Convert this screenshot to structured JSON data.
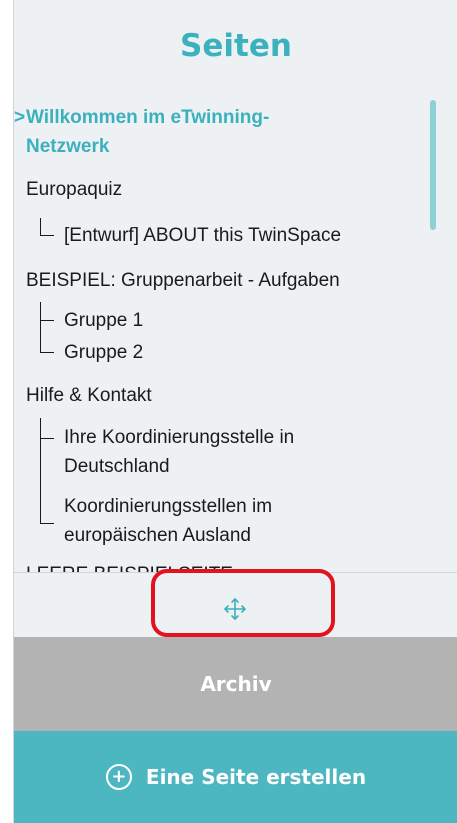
{
  "panel": {
    "title": "Seiten",
    "pages": [
      {
        "label_line1": "Willkommen im eTwinning-",
        "label_line2": "Netzwerk",
        "active": true
      },
      {
        "label": "Europaquiz"
      },
      {
        "label": "[Entwurf] ABOUT this TwinSpace"
      },
      {
        "label": "BEISPIEL: Gruppenarbeit - Aufgaben"
      },
      {
        "label": "Gruppe 1"
      },
      {
        "label": "Gruppe 2"
      },
      {
        "label": "Hilfe & Kontakt"
      },
      {
        "label_line1": "Ihre Koordinierungsstelle in",
        "label_line2": "Deutschland"
      },
      {
        "label_line1": "Koordinierungsstellen im",
        "label_line2": "europäischen Ausland"
      },
      {
        "label": "LEERE BEISPIELSEITE"
      }
    ],
    "active_indicator": ">"
  },
  "move_handle_icon": "move-arrows-icon",
  "archive_label": "Archiv",
  "create_page_label": "Eine Seite erstellen",
  "create_icon": "plus-circle-icon",
  "colors": {
    "accent": "#3ab1bd",
    "archive_bg": "#b3b3b3",
    "create_bg": "#4cb6c1",
    "highlight": "#e3121d"
  }
}
